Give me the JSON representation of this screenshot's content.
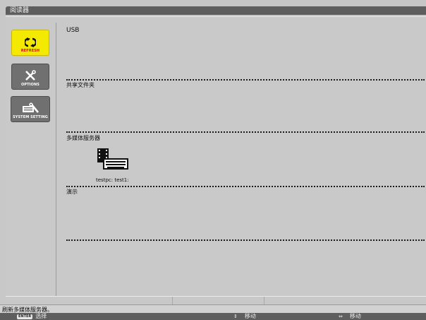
{
  "window": {
    "title": "阅读器"
  },
  "sidebar": {
    "items": [
      {
        "label": "REFRESH",
        "icon": "refresh-icon",
        "active": true
      },
      {
        "label": "OPTIONS",
        "icon": "tools-icon",
        "active": false
      },
      {
        "label": "SYSTEM SETTING",
        "icon": "system-setting-icon",
        "active": false
      }
    ]
  },
  "sections": {
    "usb": {
      "title": "USB"
    },
    "shared_folder": {
      "title": "共享文件夹"
    },
    "media_server": {
      "title": "多媒体服务器",
      "items": [
        {
          "label": "testpc: test1:",
          "icon": "media-server-icon"
        }
      ]
    },
    "demo": {
      "title": "演示"
    }
  },
  "status": {
    "text": "刷新多媒体服务器。"
  },
  "footer": {
    "select": {
      "key": "ENTER",
      "label": "选择"
    },
    "move_vertical": {
      "glyph": "⇕",
      "label": "移动"
    },
    "move_horizontal": {
      "glyph": "⇔",
      "label": "移动"
    }
  },
  "colors": {
    "background": "#c8c8c8",
    "active_button": "#f4e900",
    "active_label": "#d01010",
    "inactive_button": "#707070",
    "footer": "#5e5e5e"
  }
}
